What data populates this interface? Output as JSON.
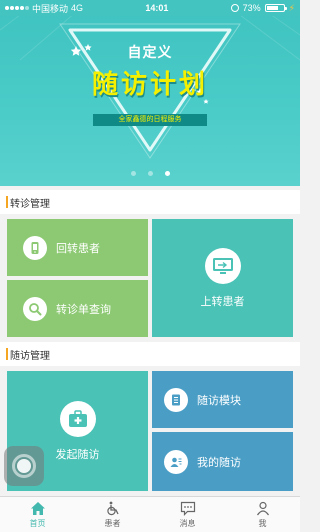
{
  "status_bar": {
    "carrier": "中国移动",
    "network": "4G",
    "time": "14:01",
    "battery_text": "73%",
    "battery_level": 0.73
  },
  "banner": {
    "title_line1": "自定义",
    "title_line2": "随访计划",
    "subtitle": "全家鑫德的日程服务",
    "page_count": 3,
    "active_page": 3
  },
  "referral_section": {
    "title": "转诊管理",
    "tiles": {
      "return_patient": "回转患者",
      "referral_query": "转诊单查询",
      "upward_patient": "上转患者"
    }
  },
  "followup_section": {
    "title": "随访管理",
    "tiles": {
      "start_followup": "发起随访",
      "followup_template": "随访模块",
      "my_followup": "我的随访"
    }
  },
  "tab_bar": {
    "items": [
      {
        "label": "首页",
        "icon": "home-icon",
        "active": true
      },
      {
        "label": "患者",
        "icon": "wheelchair-icon",
        "active": false
      },
      {
        "label": "消息",
        "icon": "message-icon",
        "active": false
      },
      {
        "label": "我",
        "icon": "person-icon",
        "active": false
      }
    ]
  },
  "colors": {
    "banner": "#44c4c0",
    "accent_yellow": "#f5f000",
    "tile_green": "#8cc972",
    "tile_teal": "#4ac2b6",
    "tile_blue": "#4a9ec6",
    "section_marker": "#f5a623",
    "tab_active": "#43b8ae"
  }
}
